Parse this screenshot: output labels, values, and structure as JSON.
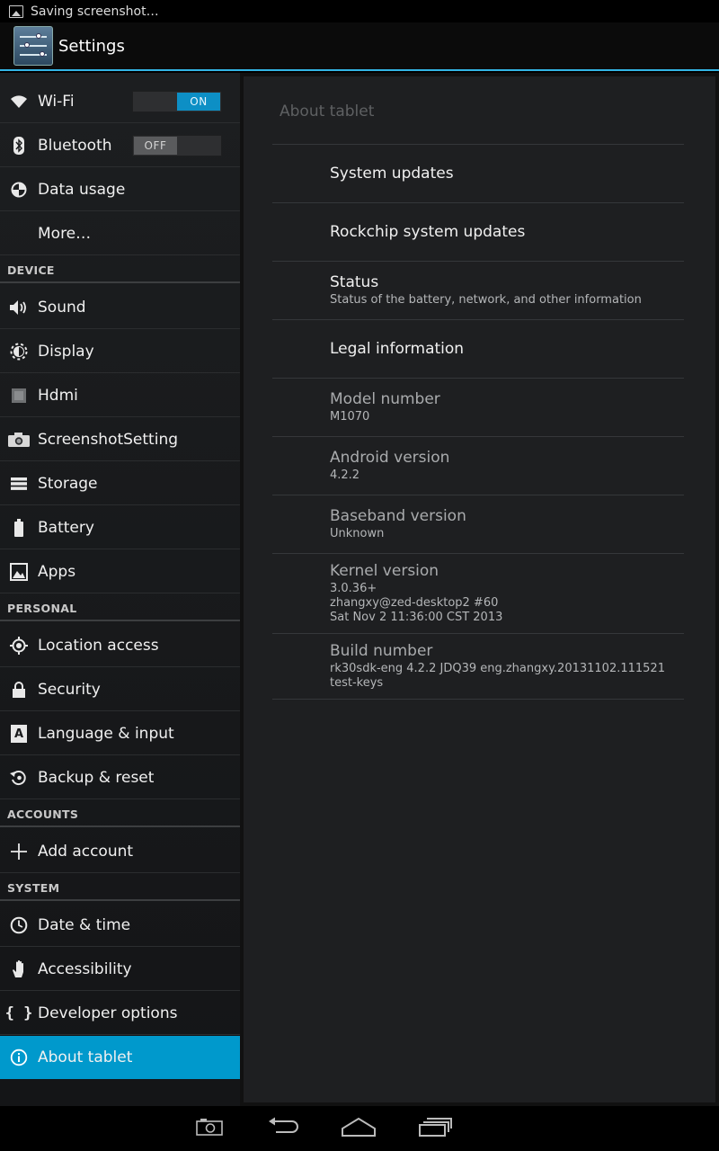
{
  "status_bar": {
    "notification": "Saving screenshot…"
  },
  "action_bar": {
    "title": "Settings"
  },
  "sidebar": {
    "wifi": {
      "label": "Wi-Fi",
      "toggle": "ON"
    },
    "bluetooth": {
      "label": "Bluetooth",
      "toggle": "OFF"
    },
    "data_usage": "Data usage",
    "more": "More…",
    "device_header": "DEVICE",
    "sound": "Sound",
    "display": "Display",
    "hdmi": "Hdmi",
    "screenshot": "ScreenshotSetting",
    "storage": "Storage",
    "battery": "Battery",
    "apps": "Apps",
    "personal_header": "PERSONAL",
    "location": "Location access",
    "security": "Security",
    "language": "Language & input",
    "backup": "Backup & reset",
    "accounts_header": "ACCOUNTS",
    "add_account": "Add account",
    "system_header": "SYSTEM",
    "date_time": "Date & time",
    "accessibility": "Accessibility",
    "developer": "Developer options",
    "about": "About tablet"
  },
  "about": {
    "title": "About tablet",
    "system_updates": "System updates",
    "rockchip_updates": "Rockchip system updates",
    "status": {
      "title": "Status",
      "summary": "Status of the battery, network, and other information"
    },
    "legal": "Legal information",
    "model": {
      "title": "Model number",
      "value": "M1070"
    },
    "android": {
      "title": "Android version",
      "value": "4.2.2"
    },
    "baseband": {
      "title": "Baseband version",
      "value": "Unknown"
    },
    "kernel": {
      "title": "Kernel version",
      "line1": "3.0.36+",
      "line2": "zhangxy@zed-desktop2 #60",
      "line3": "Sat Nov 2 11:36:00 CST 2013"
    },
    "build": {
      "title": "Build number",
      "line1": "rk30sdk-eng 4.2.2 JDQ39 eng.zhangxy.20131102.111521",
      "line2": "test-keys"
    }
  },
  "colors": {
    "accent": "#33b5e5",
    "selected": "#0099cc"
  }
}
